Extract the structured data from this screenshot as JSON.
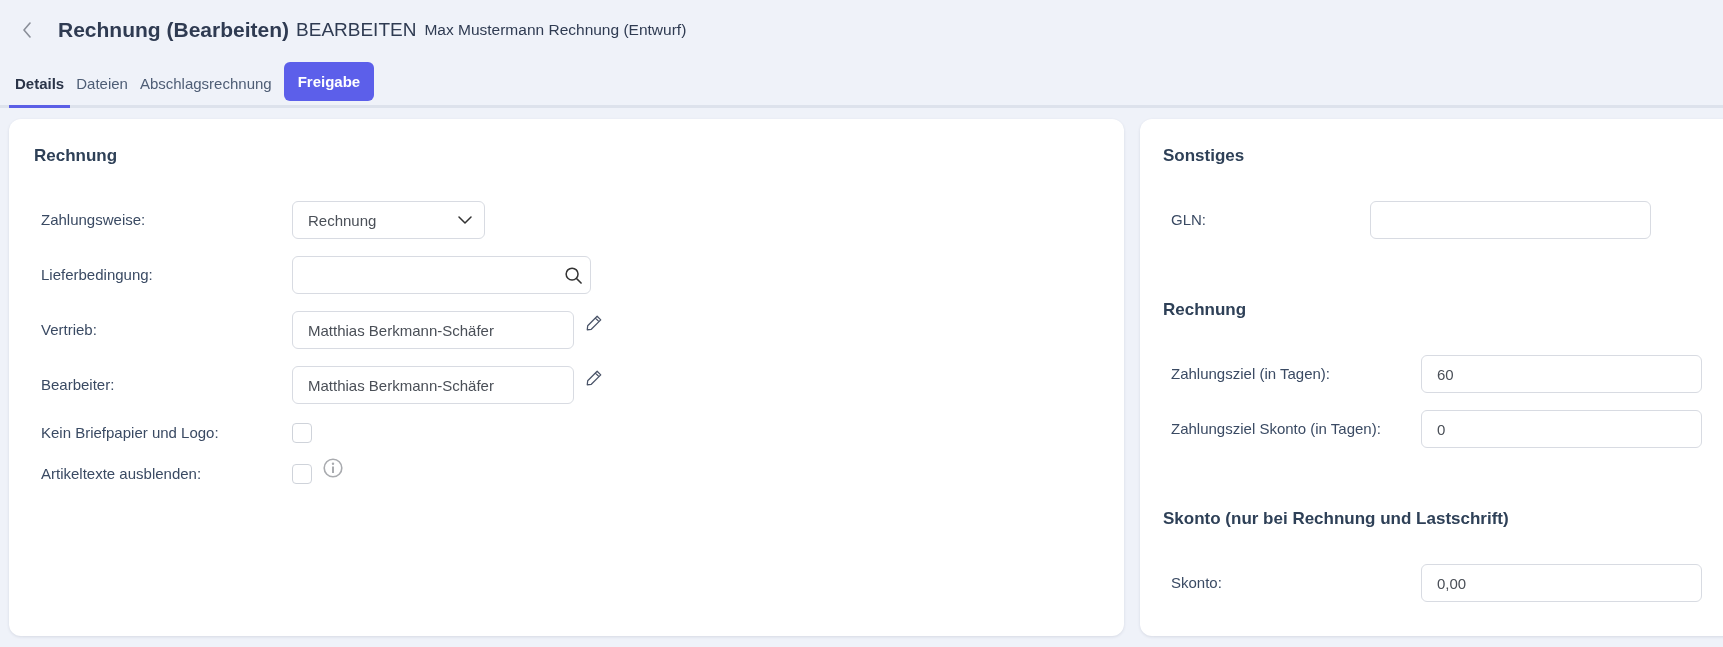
{
  "header": {
    "title": "Rechnung (Bearbeiten)",
    "mode": "BEARBEITEN",
    "subtitle": "Max Mustermann Rechnung (Entwurf)"
  },
  "tabs": [
    {
      "label": "Details",
      "selected": true
    },
    {
      "label": "Dateien",
      "selected": false
    },
    {
      "label": "Abschlagsrechnung",
      "selected": false
    }
  ],
  "action_button": {
    "label": "Freigabe"
  },
  "left_panel": {
    "title": "Rechnung",
    "fields": [
      {
        "kind": "select",
        "label": "Zahlungsweise:",
        "value": "Rechnung"
      },
      {
        "kind": "search",
        "label": "Lieferbedingung:"
      },
      {
        "kind": "text",
        "label": "Vertrieb:",
        "value": "Matthias Berkmann-Schäfer",
        "editable": true
      },
      {
        "kind": "text",
        "label": "Bearbeiter:",
        "value": "Matthias Berkmann-Schäfer",
        "editable": true
      },
      {
        "kind": "checkbox",
        "label": "Kein Briefpapier und Logo:",
        "checked": false
      },
      {
        "kind": "checkbox",
        "label": "Artikeltexte ausblenden:",
        "checked": false,
        "info": true
      }
    ]
  },
  "right_panel": {
    "sections": [
      {
        "title": "Sonstiges",
        "fields": [
          {
            "kind": "text",
            "label": "GLN:"
          }
        ]
      },
      {
        "title": "Rechnung",
        "fields": [
          {
            "kind": "text",
            "label": "Zahlungsziel (in Tagen):",
            "value": "60"
          },
          {
            "kind": "text",
            "label": "Zahlungsziel Skonto (in Tagen):",
            "value": "0"
          }
        ]
      },
      {
        "title": "Skonto (nur bei Rechnung und Lastschrift)",
        "fields": [
          {
            "kind": "text",
            "label": "Skonto:",
            "value": "0,00"
          }
        ]
      }
    ]
  }
}
